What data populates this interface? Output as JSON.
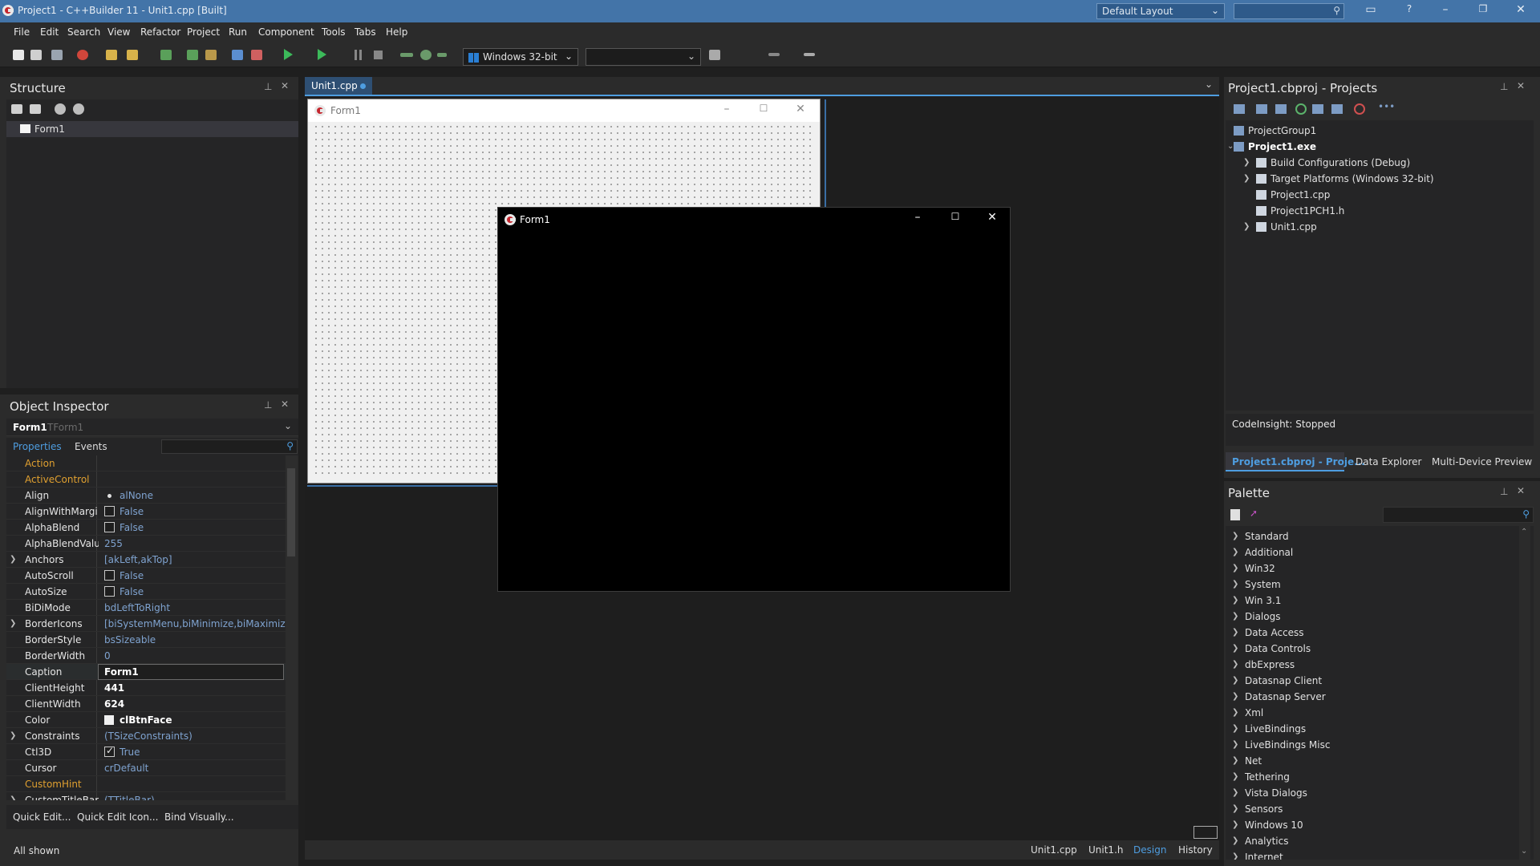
{
  "window": {
    "title": "Project1 - C++Builder 11 - Unit1.cpp [Built]",
    "layout": "Default Layout"
  },
  "menu": [
    "File",
    "Edit",
    "Search",
    "View",
    "Refactor",
    "Project",
    "Run",
    "Component",
    "Tools",
    "Tabs",
    "Help"
  ],
  "toolbar": {
    "platform": "Windows 32-bit",
    "config": ""
  },
  "structure": {
    "title": "Structure",
    "items": [
      "Form1"
    ]
  },
  "object_inspector": {
    "title": "Object Inspector",
    "selected_name": "Form1",
    "selected_type": "TForm1",
    "tabs": [
      "Properties",
      "Events"
    ],
    "properties": [
      {
        "name": "Action",
        "value": "",
        "kind": "event"
      },
      {
        "name": "ActiveControl",
        "value": "",
        "kind": "event"
      },
      {
        "name": "Align",
        "value": "alNone",
        "kind": "dot"
      },
      {
        "name": "AlignWithMargi",
        "value": "False",
        "kind": "check"
      },
      {
        "name": "AlphaBlend",
        "value": "False",
        "kind": "check"
      },
      {
        "name": "AlphaBlendValue",
        "value": "255",
        "kind": "text"
      },
      {
        "name": "Anchors",
        "value": "[akLeft,akTop]",
        "kind": "expand"
      },
      {
        "name": "AutoScroll",
        "value": "False",
        "kind": "check"
      },
      {
        "name": "AutoSize",
        "value": "False",
        "kind": "check"
      },
      {
        "name": "BiDiMode",
        "value": "bdLeftToRight",
        "kind": "text"
      },
      {
        "name": "BorderIcons",
        "value": "[biSystemMenu,biMinimize,biMaximize]",
        "kind": "expand"
      },
      {
        "name": "BorderStyle",
        "value": "bsSizeable",
        "kind": "text"
      },
      {
        "name": "BorderWidth",
        "value": "0",
        "kind": "text"
      },
      {
        "name": "Caption",
        "value": "Form1",
        "kind": "edit"
      },
      {
        "name": "ClientHeight",
        "value": "441",
        "kind": "bold"
      },
      {
        "name": "ClientWidth",
        "value": "624",
        "kind": "bold"
      },
      {
        "name": "Color",
        "value": "clBtnFace",
        "kind": "color"
      },
      {
        "name": "Constraints",
        "value": "(TSizeConstraints)",
        "kind": "expand"
      },
      {
        "name": "Ctl3D",
        "value": "True",
        "kind": "checkon"
      },
      {
        "name": "Cursor",
        "value": "crDefault",
        "kind": "text"
      },
      {
        "name": "CustomHint",
        "value": "",
        "kind": "event"
      },
      {
        "name": "CustomTitleBar",
        "value": "(TTitleBar)",
        "kind": "expand"
      }
    ],
    "quick_links": "Quick Edit...  Quick Edit Icon...  Bind Visually...",
    "status": "All shown"
  },
  "editor": {
    "tab": "Unit1.cpp",
    "design_form_caption": "Form1",
    "run_form_caption": "Form1",
    "bottom_tabs": [
      "Unit1.cpp",
      "Unit1.h",
      "Design",
      "History"
    ]
  },
  "projects": {
    "title": "Project1.cbproj - Projects",
    "tree": [
      {
        "label": "ProjectGroup1",
        "level": 0,
        "exp": ""
      },
      {
        "label": "Project1.exe",
        "level": 0,
        "exp": "open",
        "bold": true
      },
      {
        "label": "Build Configurations (Debug)",
        "level": 1,
        "exp": "closed"
      },
      {
        "label": "Target Platforms (Windows 32-bit)",
        "level": 1,
        "exp": "closed"
      },
      {
        "label": "Project1.cpp",
        "level": 1,
        "exp": ""
      },
      {
        "label": "Project1PCH1.h",
        "level": 1,
        "exp": ""
      },
      {
        "label": "Unit1.cpp",
        "level": 1,
        "exp": "closed"
      }
    ],
    "codeinsight": "CodeInsight: Stopped",
    "tabs": [
      "Project1.cbproj - Proje...",
      "Data Explorer",
      "Multi-Device Preview"
    ]
  },
  "palette": {
    "title": "Palette",
    "categories": [
      "Standard",
      "Additional",
      "Win32",
      "System",
      "Win 3.1",
      "Dialogs",
      "Data Access",
      "Data Controls",
      "dbExpress",
      "Datasnap Client",
      "Datasnap Server",
      "Xml",
      "LiveBindings",
      "LiveBindings Misc",
      "Net",
      "Tethering",
      "Vista Dialogs",
      "Sensors",
      "Windows 10",
      "Analytics",
      "Internet"
    ]
  },
  "colors": {
    "titlebar": "#4374a8",
    "accent": "#4e9de0",
    "panel": "#252526",
    "event_name": "#e0a030",
    "value": "#7fa3d0"
  }
}
